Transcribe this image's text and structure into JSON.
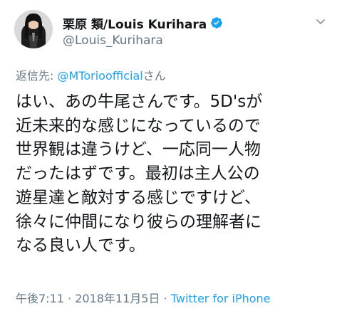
{
  "user": {
    "display_name": "栗原 類/Louis Kurihara",
    "handle": "@Louis_Kurihara",
    "verified": true
  },
  "reply": {
    "prefix": "返信先: ",
    "mention": "@MTorioofficial",
    "suffix": "さん"
  },
  "tweet": {
    "lines": [
      "はい、あの牛尾さんです。5D'sが",
      "近未来的な感じになっているので",
      "世界観は違うけど、一応同一人物",
      "だったはずです。最初は主人公の",
      "遊星達と敵対する感じですけど、",
      "徐々に仲間になり彼らの理解者に",
      "なる良い人です。"
    ]
  },
  "meta": {
    "time": "午後7:11",
    "separator1": " · ",
    "date": "2018年11月5日",
    "separator2": " · ",
    "source": "Twitter for iPhone"
  },
  "colors": {
    "accent": "#1da1f2",
    "secondary_text": "#657786",
    "primary_text": "#14171a"
  },
  "icons": {
    "verified": "verified-badge-icon",
    "menu": "chevron-down-icon"
  }
}
